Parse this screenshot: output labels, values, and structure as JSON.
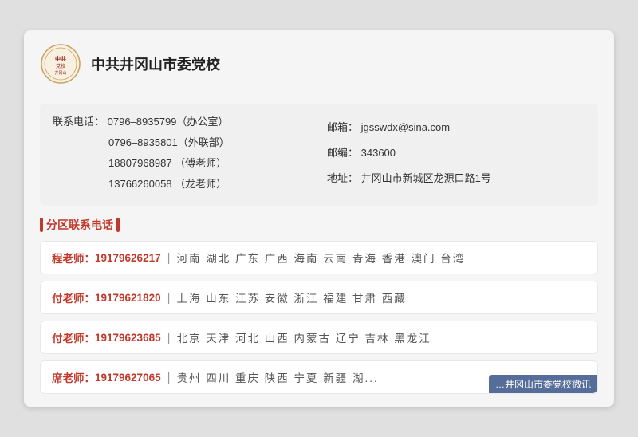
{
  "header": {
    "org_name": "中共井冈山市委党校"
  },
  "contact": {
    "phone_label": "联系电话：",
    "phone1": "0796–8935799（办公室）",
    "phone2": "0796–8935801（外联部）",
    "phone3": "18807968987 （傅老师）",
    "phone4": "13766260058 （龙老师）",
    "email_label": "邮箱：",
    "email": "jgsswdx@sina.com",
    "postcode_label": "邮编：",
    "postcode": "343600",
    "address_label": "地址：",
    "address": "井冈山市新城区龙源口路1号"
  },
  "section_title": "分区联系电话",
  "regions": [
    {
      "teacher": "程老师：",
      "phone": "19179626217",
      "areas": "河南  湖北  广东  广西  海南  云南  青海  香港  澳门  台湾"
    },
    {
      "teacher": "付老师：",
      "phone": "19179621820",
      "areas": "上海  山东  江苏  安徽  浙江  福建  甘肃  西藏"
    },
    {
      "teacher": "付老师：",
      "phone": "19179623685",
      "areas": "北京  天津  河北  山西  内蒙古  辽宁  吉林  黑龙江"
    },
    {
      "teacher": "席老师：",
      "phone": "19179627065",
      "areas": "贵州  四川  重庆  陕西  宁夏  新疆  湖..."
    }
  ],
  "watermark": "…井冈山市委党校微讯"
}
